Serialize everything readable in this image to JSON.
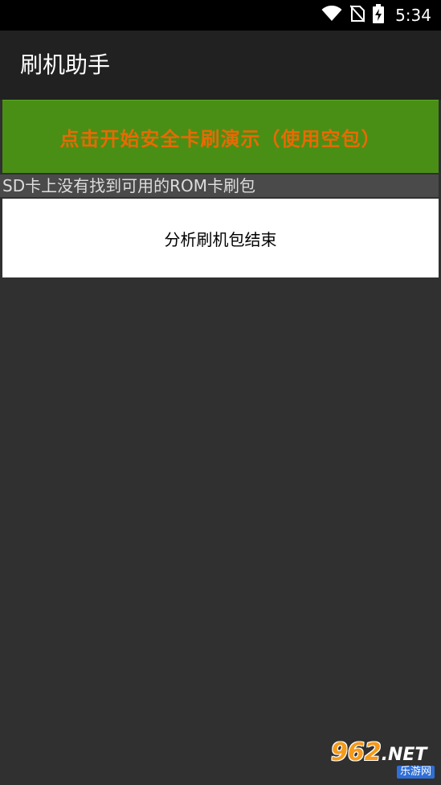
{
  "status_bar": {
    "time": "5:34",
    "icons": [
      "wifi-icon",
      "no-sim-icon",
      "battery-charging-icon"
    ]
  },
  "app_bar": {
    "title": "刷机助手"
  },
  "start_button": {
    "label": "点击开始安全卡刷演示（使用空包）",
    "background_color": "#4a8f15",
    "text_color": "#e86a05"
  },
  "status_message": "SD卡上没有找到可用的ROM卡刷包",
  "result_panel": {
    "text": "分析刷机包结束"
  },
  "watermark": {
    "main": "962",
    "suffix": ".NET",
    "sub": "乐游网"
  }
}
